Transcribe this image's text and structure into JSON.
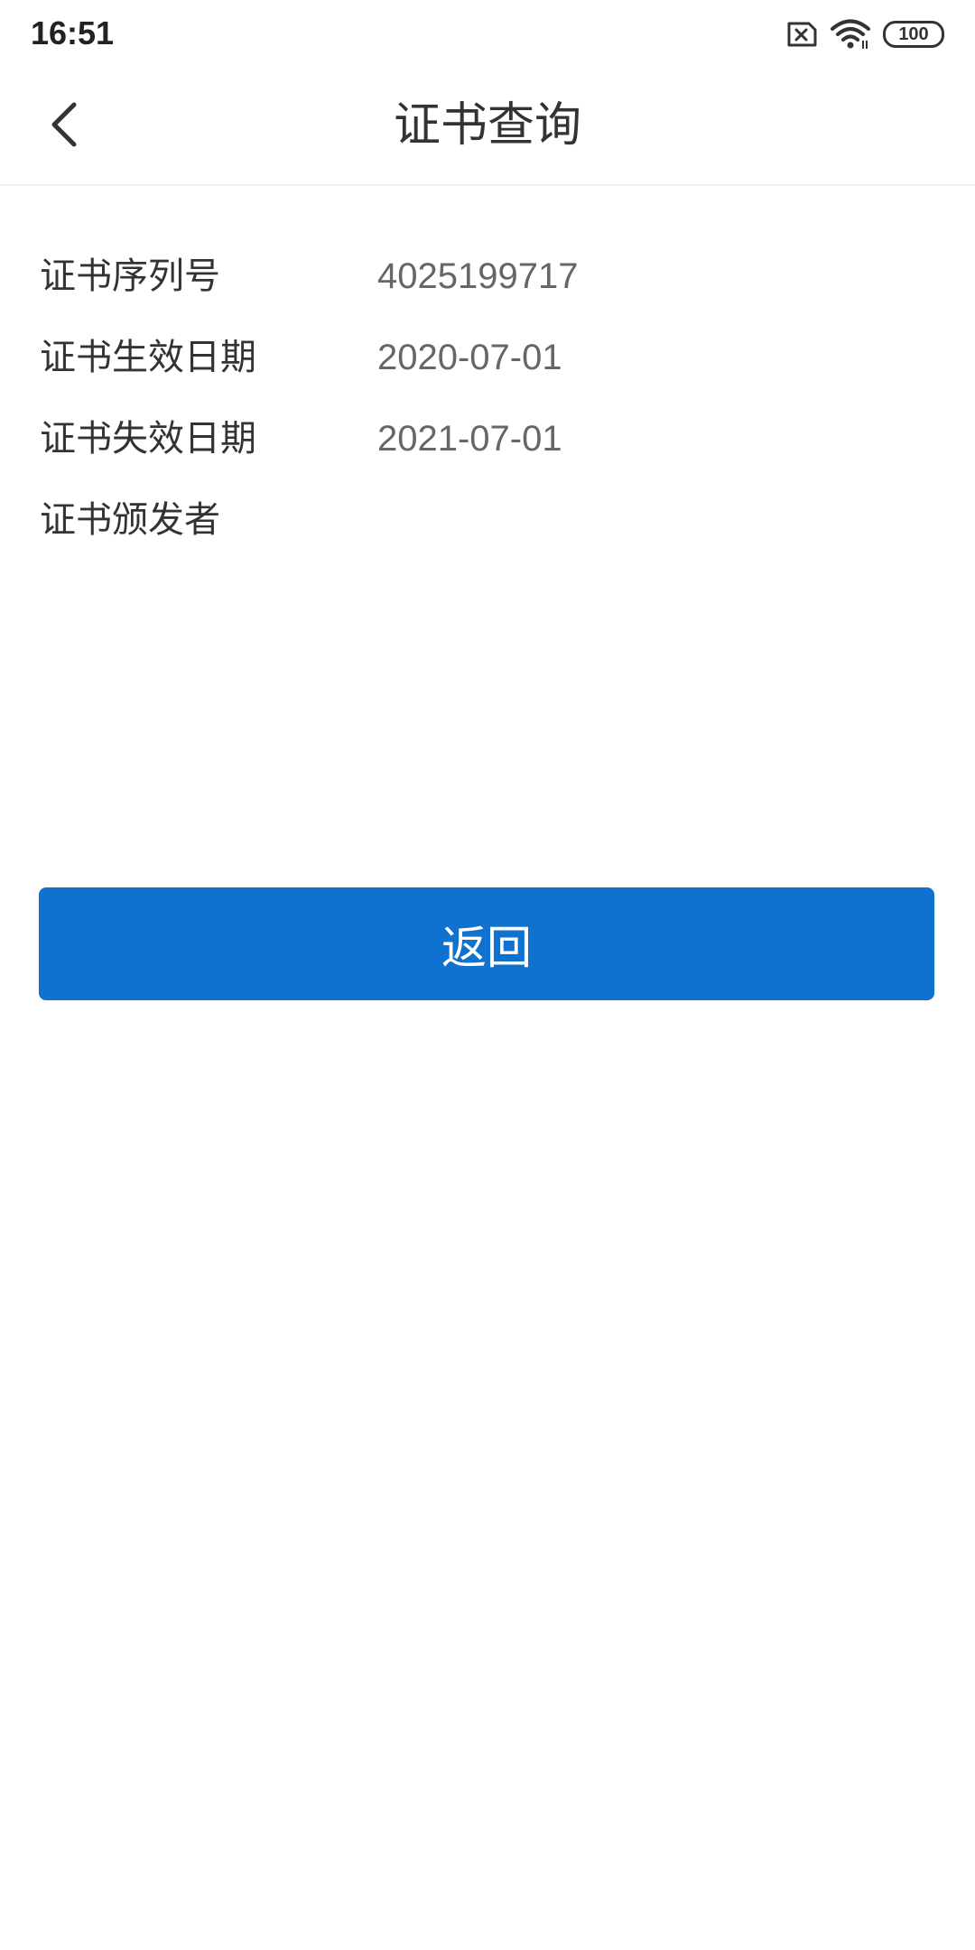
{
  "status_bar": {
    "time": "16:51",
    "battery_level": "100",
    "icons": [
      "sim-error-icon",
      "wifi-icon",
      "battery-icon"
    ]
  },
  "header": {
    "title": "证书查询",
    "back_icon": "chevron-left-icon"
  },
  "certificate": {
    "rows": [
      {
        "label": "证书序列号",
        "value": "4025199717"
      },
      {
        "label": "证书生效日期",
        "value": "2020-07-01"
      },
      {
        "label": "证书失效日期",
        "value": "2021-07-01"
      },
      {
        "label": "证书颁发者",
        "value": ""
      }
    ]
  },
  "actions": {
    "return_label": "返回"
  },
  "colors": {
    "primary": "#1072cf",
    "text": "#333333",
    "value_text": "#666666",
    "background": "#ffffff"
  }
}
